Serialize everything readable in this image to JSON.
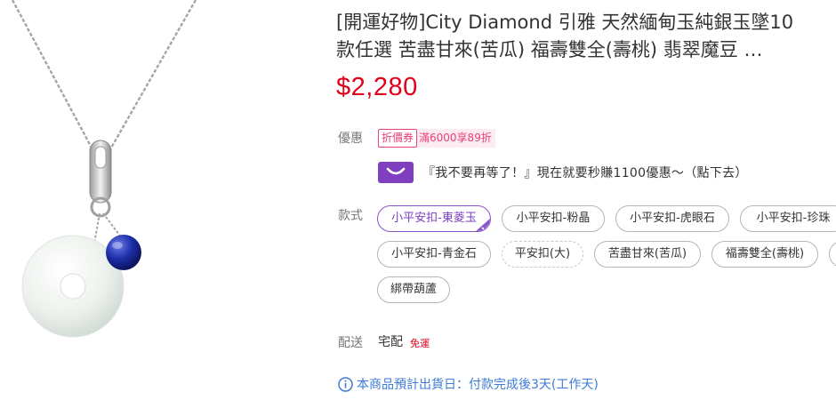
{
  "product": {
    "title_line1": "[開運好物]City Diamond 引雅 天然緬甸玉純銀玉墜10",
    "title_line2": "款任選 苦盡甘來(苦瓜) 福壽雙全(壽桃) 翡翠魔豆 …",
    "price": "$2,280"
  },
  "offers": {
    "label": "優惠",
    "coupon_tag": "折價券",
    "coupon_text": "滿6000享89折",
    "promo_text": "『我不要再等了！』現在就要秒賺1100優惠～（點下去）"
  },
  "styles": {
    "label": "款式",
    "options": [
      {
        "label": "小平安扣-東菱玉"
      },
      {
        "label": "小平安扣-粉晶"
      },
      {
        "label": "小平安扣-虎眼石"
      },
      {
        "label": "小平安扣-珍珠"
      },
      {
        "label": "小平安扣-青金石"
      },
      {
        "label": "平安扣(大)"
      },
      {
        "label": "苦盡甘來(苦瓜)"
      },
      {
        "label": "福壽雙全(壽桃)"
      },
      {
        "label": ""
      },
      {
        "label": "綁帶葫蘆"
      }
    ]
  },
  "shipping": {
    "label": "配送",
    "method": "宅配",
    "free": "免運",
    "eta": "本商品預計出貨日：付款完成後3天(工作天)"
  },
  "colors": {
    "price": "#e3001b",
    "accent_purple": "#8a55c8",
    "coupon_pink": "#e6417a",
    "info_blue": "#3d7bd6"
  },
  "icons": {
    "promo": "smile-bag-icon",
    "selected": "checkmark-icon",
    "eta": "info-icon"
  }
}
